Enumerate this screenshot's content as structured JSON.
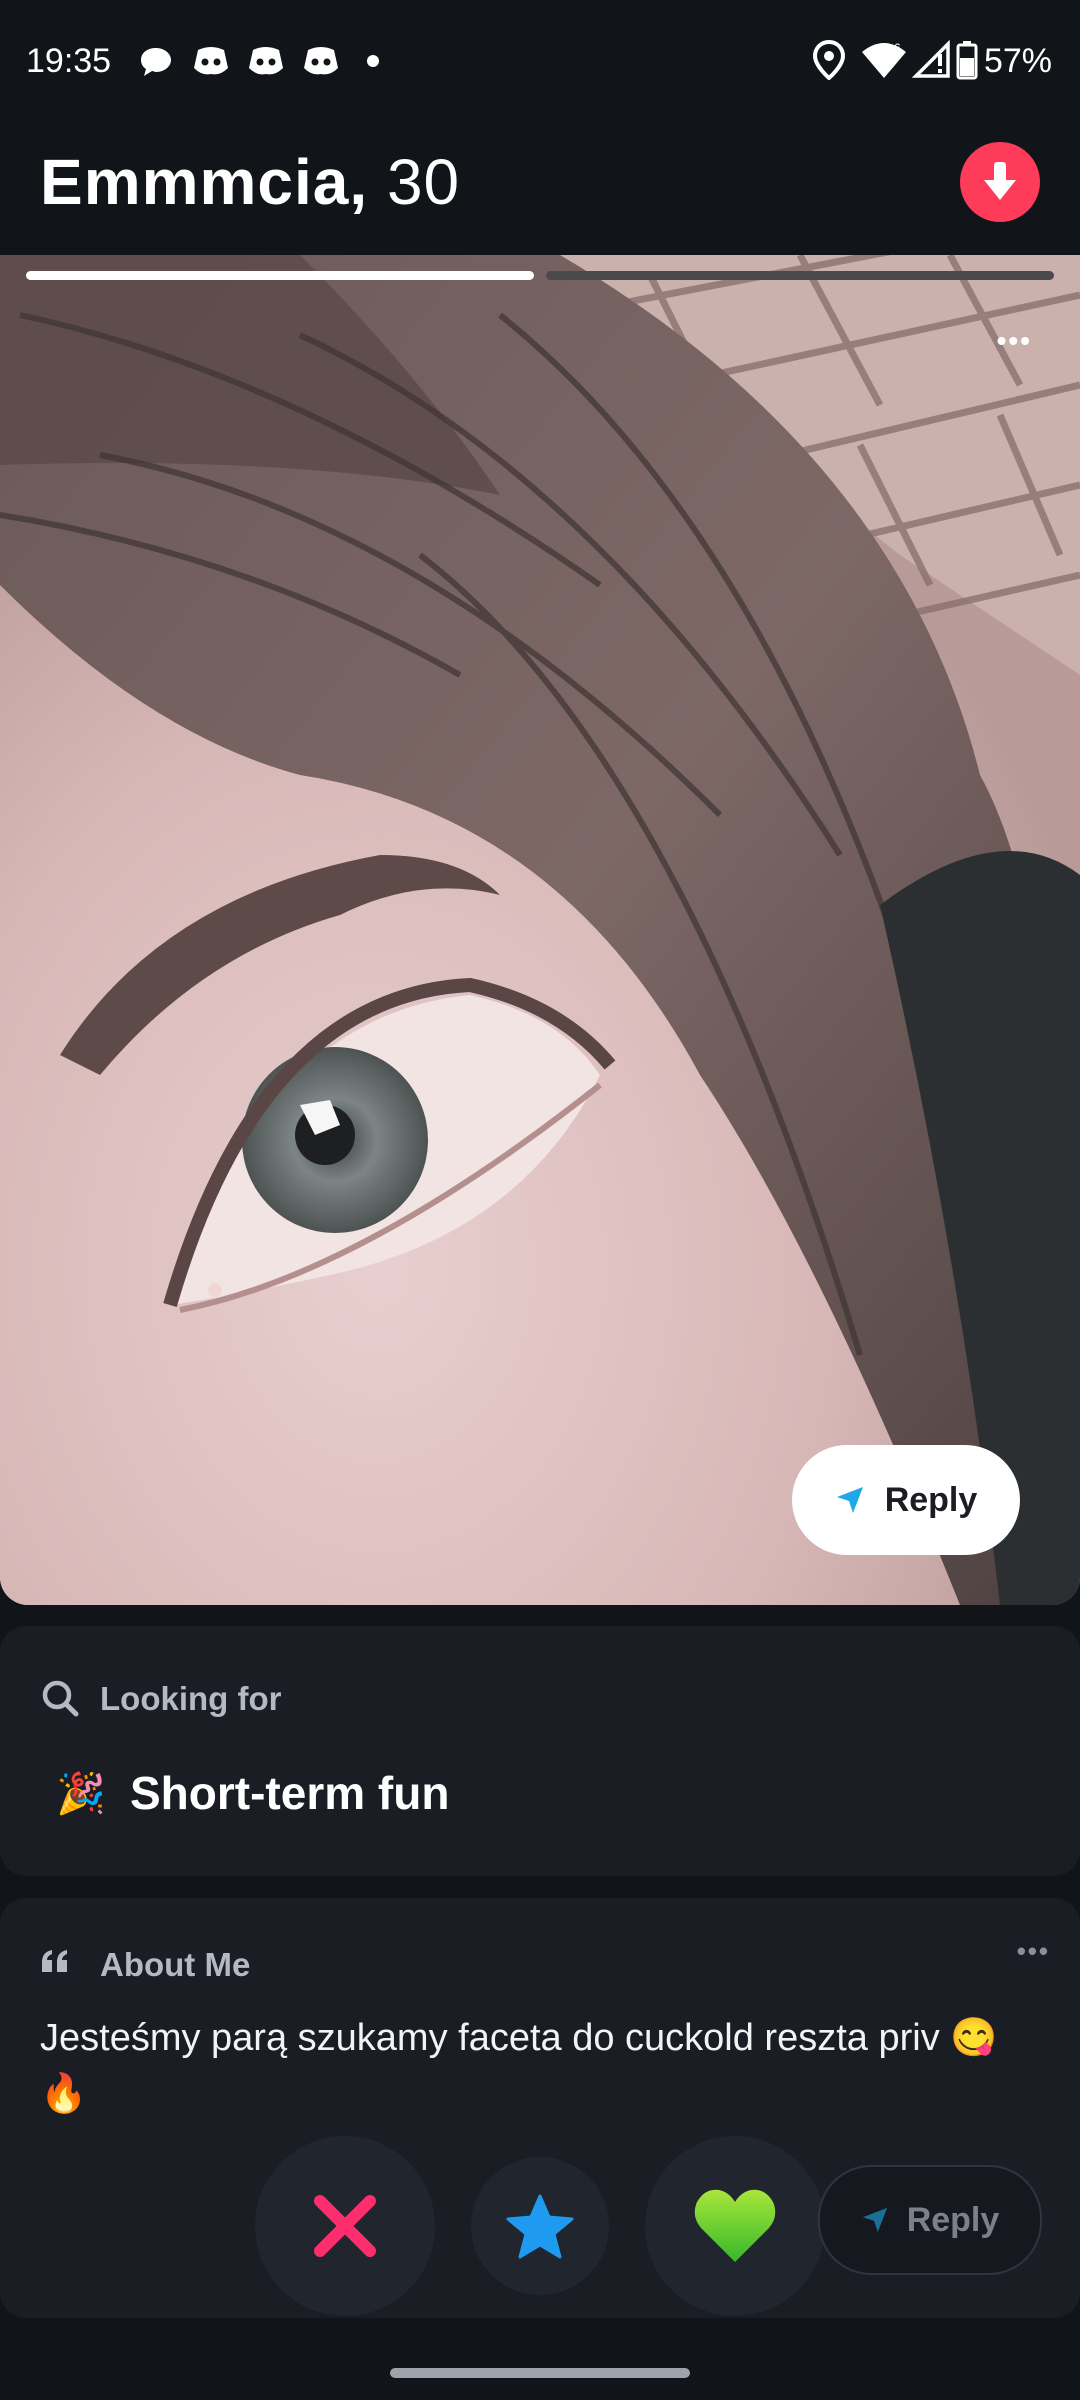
{
  "status_bar": {
    "time": "19:35",
    "battery": "57%",
    "icons": [
      "chat-bubble-icon",
      "discord-icon",
      "discord-icon",
      "discord-icon",
      "dot-icon",
      "location-icon",
      "wifi-icon",
      "signal-icon",
      "battery-icon"
    ]
  },
  "profile": {
    "name": "Emmmcia,",
    "age": "30",
    "photo_index": 1,
    "photo_count": 2
  },
  "photo": {
    "reply_label": "Reply"
  },
  "looking_for": {
    "title": "Looking for",
    "value": "Short-term fun",
    "emoji": "🎉"
  },
  "about_me": {
    "title": "About Me",
    "text": "Jesteśmy parą szukamy faceta do cuckold reszta priv 😋🔥"
  },
  "actions": {
    "reply_label": "Reply"
  },
  "colors": {
    "accent": "#fe3c5a",
    "nope": "#fe2d6d",
    "superlike": "#1e9bf0",
    "like": "#6ad02a",
    "background": "#111418",
    "card": "#1a1d24"
  }
}
